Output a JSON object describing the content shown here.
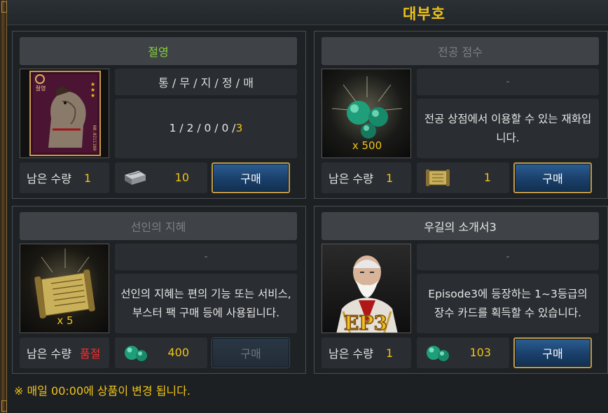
{
  "header": {
    "title": "대부호"
  },
  "cards": [
    {
      "title": "절영",
      "stats_header": "통 / 무 / 지 / 정 / 매",
      "stats_values": "1 / 2 / 0 / 0 / ",
      "stats_highlight": "3",
      "remain_label": "남은 수량",
      "remain_value": "1",
      "price": "10",
      "price_icon": "iron-ingot-icon",
      "buy_label": "구매",
      "thumb_vertical_text": "절영",
      "thumb_side_text": "N0.0211100"
    },
    {
      "title": "전공 점수",
      "subtitle": "-",
      "description": "전공 상점에서 이용할 수 있는 재화입니다.",
      "thumb_count": "x 500",
      "remain_label": "남은 수량",
      "remain_value": "1",
      "price": "1",
      "price_icon": "scroll-icon",
      "buy_label": "구매"
    },
    {
      "title": "선인의 지혜",
      "subtitle": "-",
      "description": "선인의 지혜는 편의 기능 또는 서비스, 부스터 팩 구매 등에 사용됩니다.",
      "thumb_count": "x 5",
      "remain_label": "남은 수량",
      "remain_value": "품절",
      "price": "400",
      "price_icon": "jade-orbs-icon",
      "buy_label": "구매"
    },
    {
      "title": "우길의 소개서3",
      "subtitle": "-",
      "description": "Episode3에 등장하는 1~3등급의 장수 카드를 획득할 수 있습니다.",
      "thumb_badge": "EP3",
      "remain_label": "남은 수량",
      "remain_value": "1",
      "price": "103",
      "price_icon": "jade-orbs-icon",
      "buy_label": "구매"
    }
  ],
  "notice": "※ 매일 00:00에 상품이 변경 됩니다.",
  "colors": {
    "accent_gold": "#f0c419",
    "title_green": "#86d23c",
    "soldout_red": "#ff2b2b",
    "buy_blue": "#1a3f6a"
  }
}
